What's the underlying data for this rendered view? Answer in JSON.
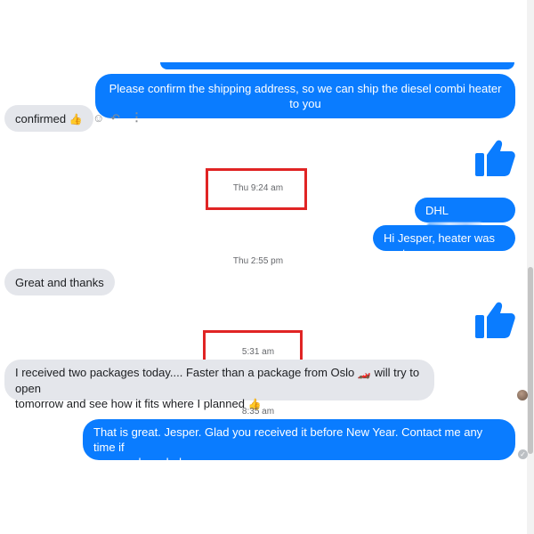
{
  "colors": {
    "outgoing": "#0a7cff",
    "incoming": "#e4e6eb",
    "highlight": "#e02424",
    "timestamp": "#65676b"
  },
  "messages": {
    "shipping_request": "Please confirm the shipping address, so we can ship the diesel combi heater to you",
    "confirmed": "confirmed",
    "dhl_prefix": "DHL",
    "heater_sent": "Hi Jesper, heater was sent",
    "great_thanks": "Great and thanks",
    "packages_line1": "I received two packages today.... Faster than a package from Oslo",
    "packages_line2": "will try to open",
    "packages_line3": "tomorrow and see how it fits where I planned",
    "reply_line1": "That is great. Jesper. Glad you received it before New Year. Contact me any time if",
    "reply_line2": "you need any help."
  },
  "timestamps": {
    "t1": "Thu 9:24 am",
    "t2": "Thu 2:55 pm",
    "t3": "5:31 am",
    "t4": "8:35 am"
  },
  "icons": {
    "thumbs_up": "thumbs-up-icon",
    "react": "smiley-icon",
    "reply": "reply-icon",
    "more": "more-icon",
    "emoji_thumb": "thumbs-up-emoji",
    "emoji_car": "race-car-emoji"
  }
}
